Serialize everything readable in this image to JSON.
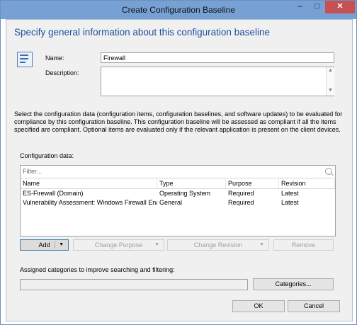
{
  "window": {
    "title": "Create Configuration Baseline",
    "minimize": "–",
    "maximize": "□",
    "close": "✕"
  },
  "heading": "Specify general information about this configuration baseline",
  "icon": "baseline-wizard-icon",
  "form": {
    "name_label": "Name:",
    "name_value": "Firewall",
    "description_label": "Description:",
    "description_value": ""
  },
  "instructions": "Select the configuration data (configuration items, configuration baselines, and software updates) to be evaluated for compliance by this configuration baseline. This configuration baseline will be assessed as compliant if all the items specified are compliant. Optional items are evaluated only if the relevant application is present on  the client devices.",
  "config_data": {
    "label": "Configuration data:",
    "filter_placeholder": "Filter...",
    "columns": [
      "Name",
      "Type",
      "Purpose",
      "Revision"
    ],
    "rows": [
      [
        "ES-Firewall (Domain)",
        "Operating System",
        "Required",
        "Latest"
      ],
      [
        "Vulnerability Assessment: Windows Firewall Ena...",
        "General",
        "Required",
        "Latest"
      ]
    ]
  },
  "buttons": {
    "add": "Add",
    "change_purpose": "Change Purpose",
    "change_revision": "Change Revision",
    "remove": "Remove",
    "categories": "Categories...",
    "ok": "OK",
    "cancel": "Cancel"
  },
  "categories": {
    "label": "Assigned categories to improve searching and filtering:",
    "value": ""
  }
}
